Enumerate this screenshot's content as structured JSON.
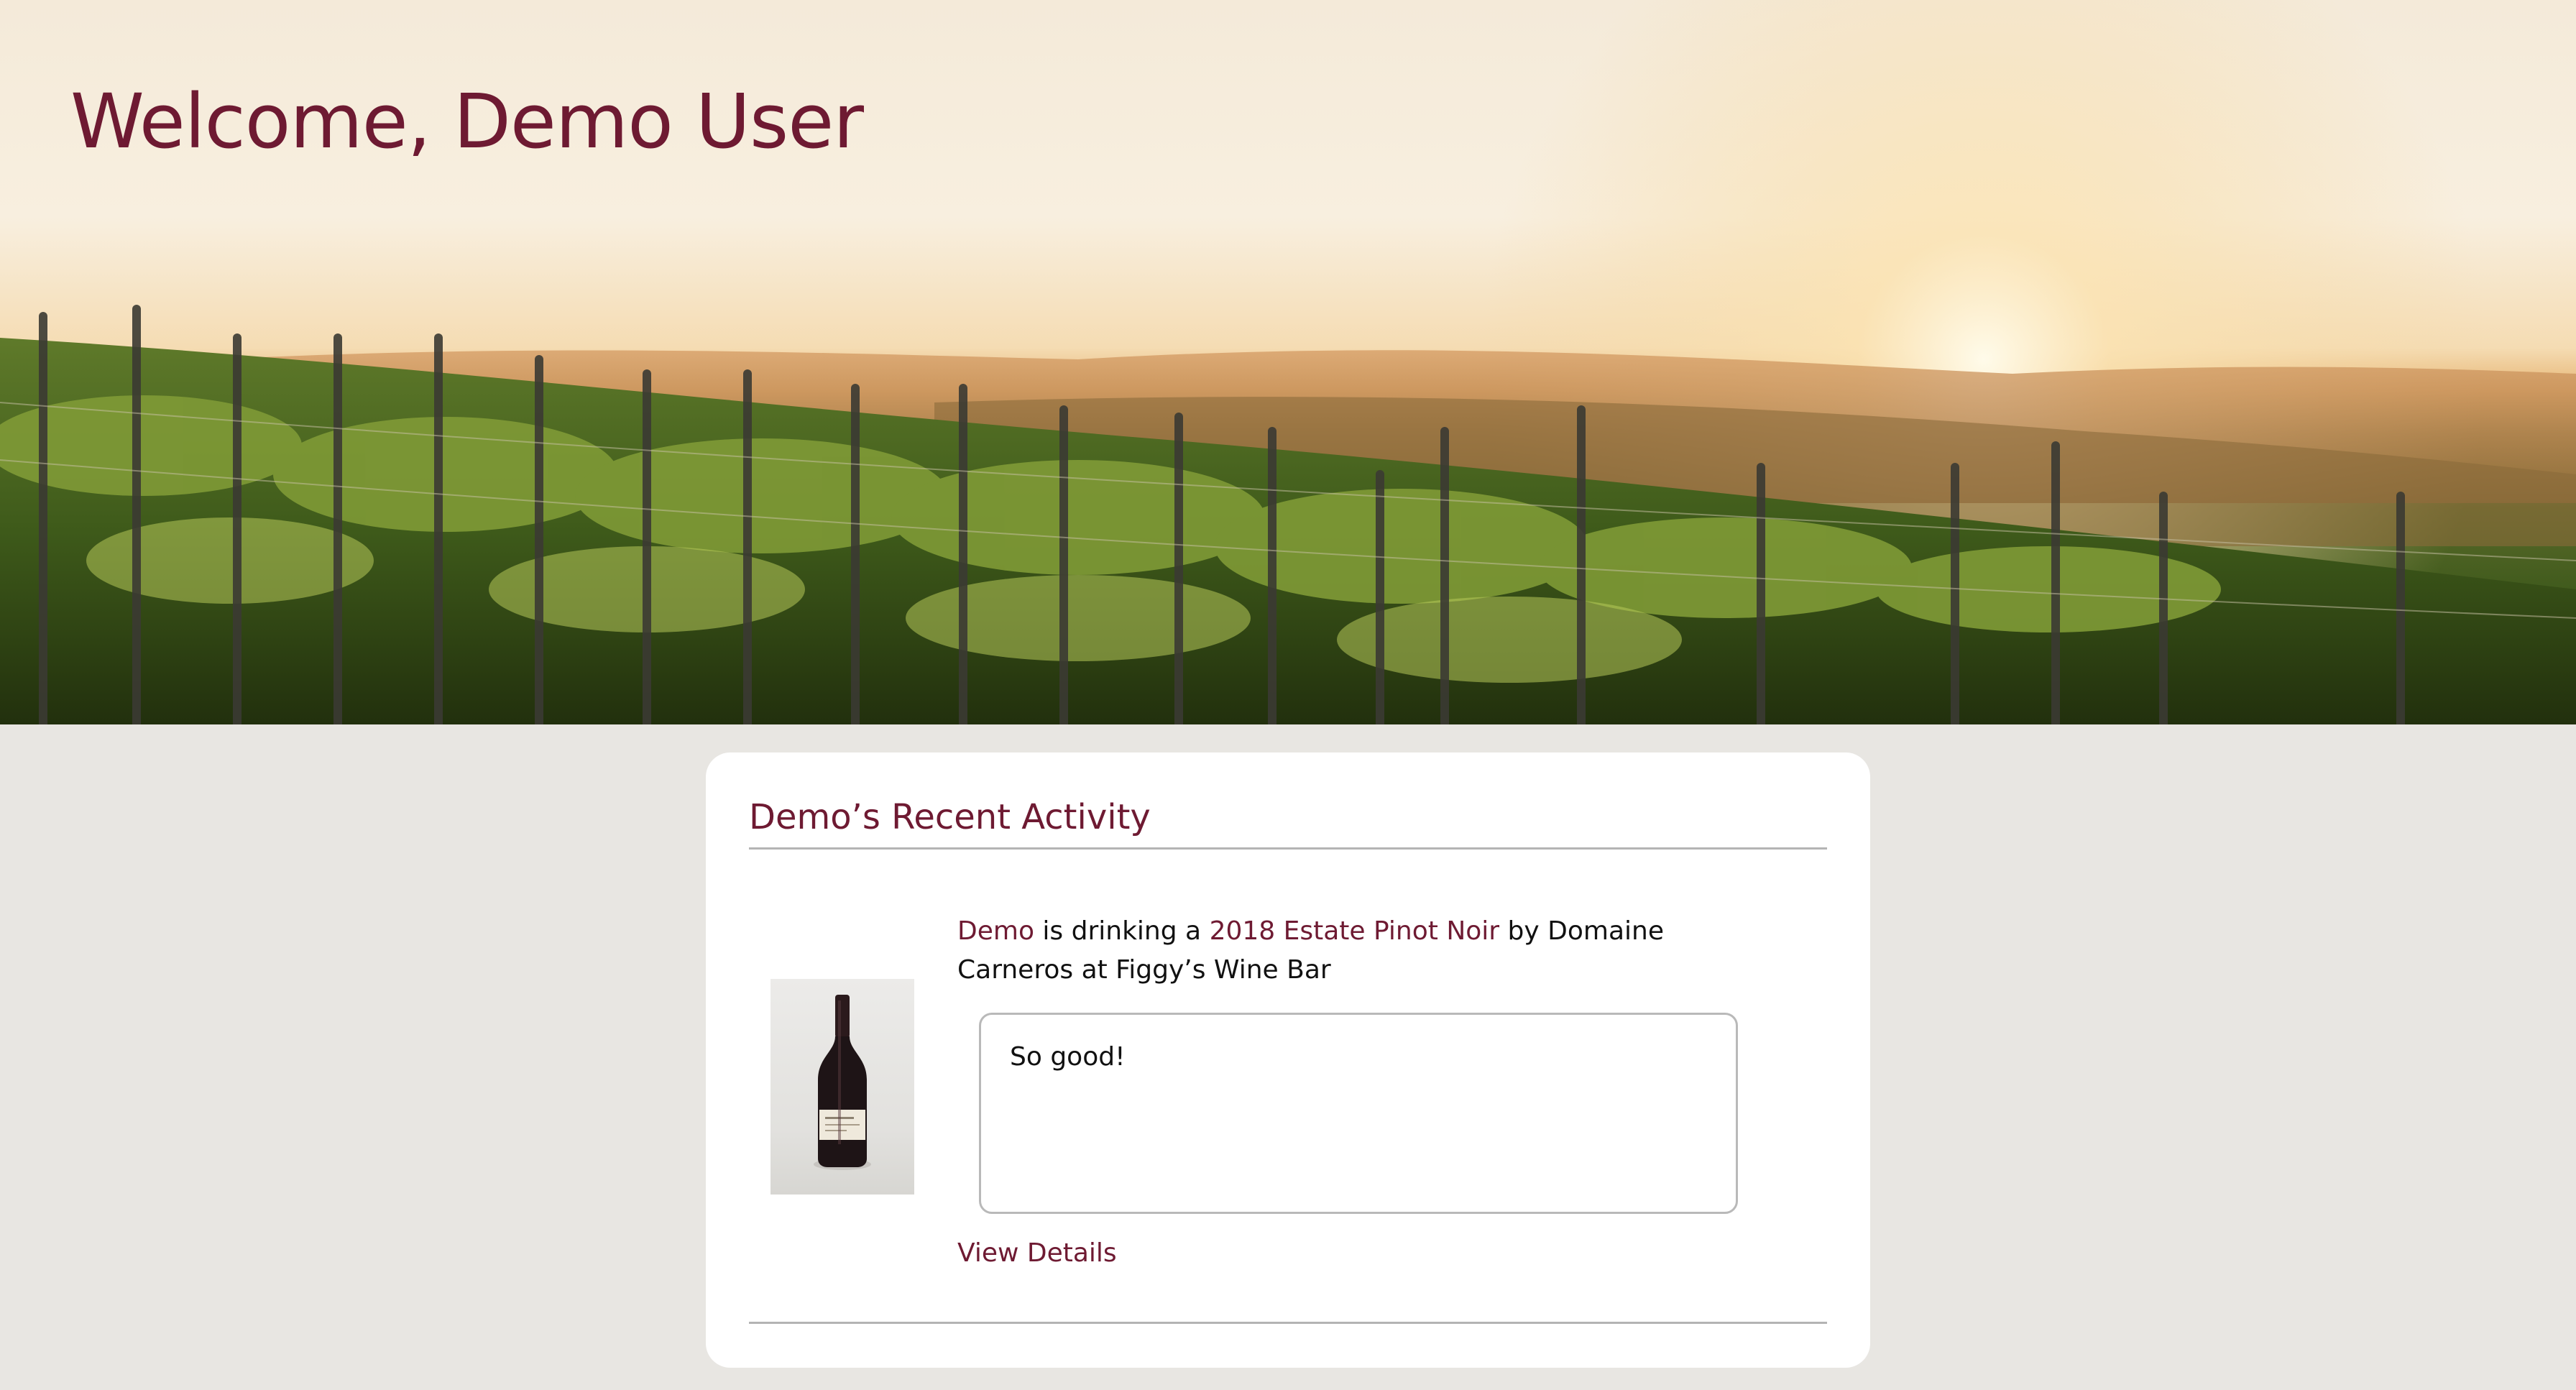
{
  "header": {
    "welcome": "Welcome, Demo User"
  },
  "activity": {
    "title": "Demo’s Recent Activity",
    "items": [
      {
        "user": "Demo",
        "text_1": " is drinking a ",
        "wine": "2018 Estate Pinot Noir",
        "text_2": " by Domaine Carneros at Figgy’s Wine Bar",
        "comment": "So good!",
        "view_details": "View Details"
      }
    ]
  },
  "colors": {
    "accent": "#6e1a32",
    "background": "#e8e6e2",
    "card": "#ffffff"
  }
}
